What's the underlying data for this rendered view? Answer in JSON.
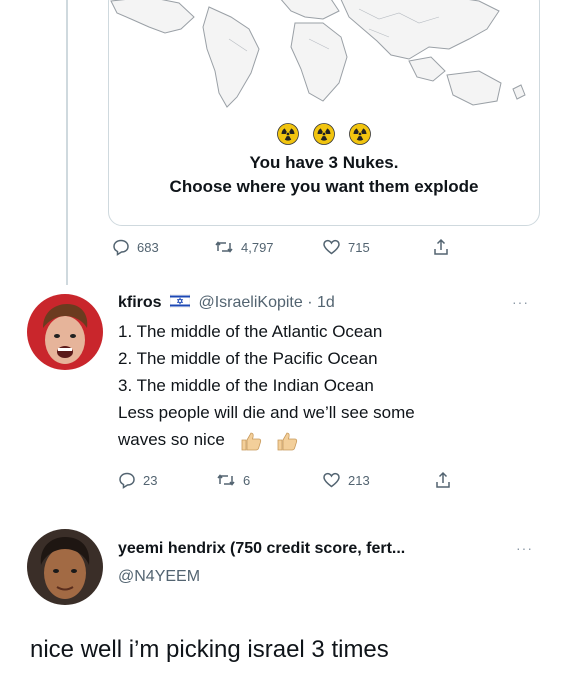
{
  "tweet1": {
    "card_line1": "You have 3 Nukes.",
    "card_line2": "Choose where you want them explode",
    "stats": {
      "replies": "683",
      "retweets": "4,797",
      "likes": "715"
    }
  },
  "tweet2": {
    "name": "kfiros",
    "flag_icon": "israel-flag-icon",
    "handle": "@IsraeliKopite",
    "separator": "·",
    "time": "1d",
    "more": "···",
    "lines": [
      "1. The middle of the Atlantic Ocean",
      "2. The middle of the Pacific Ocean",
      "3. The middle of the Indian Ocean",
      "Less people will die and we’ll see some",
      "waves so nice"
    ],
    "stats": {
      "replies": "23",
      "retweets": "6",
      "likes": "213"
    }
  },
  "tweet3": {
    "name": "yeemi hendrix (750 credit score, fert...",
    "handle": "@N4YEEM",
    "more": "···",
    "text": "nice well i’m picking israel 3 times"
  },
  "colors": {
    "text": "#0f1419",
    "muted": "#536471",
    "border": "#cfd9de",
    "radiation": "#f1c40f"
  }
}
